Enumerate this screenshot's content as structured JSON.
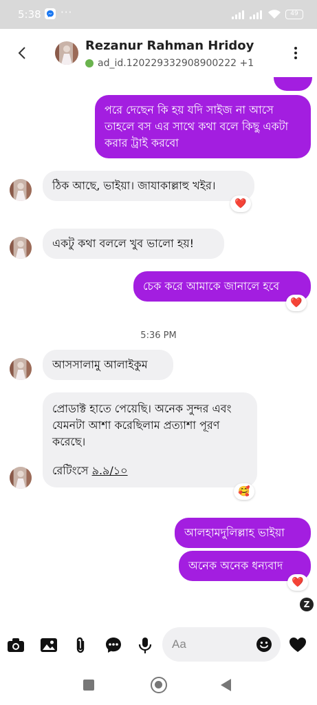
{
  "status": {
    "time": "5:38",
    "dots": "···",
    "battery": "49"
  },
  "header": {
    "contact_name": "Rezanur Rahman Hridoy",
    "sub_id": "ad_id.120229332908900222 +1"
  },
  "messages": {
    "m1_out": "পরে দেছেন কি হয় যদি সাইজ না আসে তাহলে বস এর সাথে কথা বলে কিছু একটা করার ট্রাই করবো",
    "m2_in": "ঠিক আছে, ভাইয়া। জাযাকাল্লাহু খইর।",
    "m2_reaction": "❤️",
    "m3_in": "একটু কথা বললে খুব ভালো হয়!",
    "m4_out": "চেক করে আমাকে জানালে হবে",
    "m4_reaction": "❤️",
    "time_separator": "5:36 PM",
    "m5_in": "আসসালামু আলাইকুম",
    "m6_in_p1": "প্রোডাক্ট হাতে পেয়েছি। অনেক সুন্দর এবং যেমনটা আশা করেছিলাম প্রত্যাশা পূরণ করেছে।",
    "m6_in_p2_label": "রেটিংসে ",
    "m6_in_p2_value": "৯.৯/১০",
    "m6_reaction": "🥰",
    "m7_out": "আলহামদুলিল্লাহ ভাইয়া",
    "m8_out": "অনেক অনেক ধন্যবাদ",
    "m8_reaction": "❤️",
    "seen_badge": "Z"
  },
  "composer": {
    "placeholder": "Aa"
  },
  "icons": {
    "back": "chevron-left-icon",
    "more": "more-vertical-icon",
    "camera": "camera-icon",
    "gallery": "image-icon",
    "attach": "paperclip-icon",
    "chat": "chat-bubble-icon",
    "mic": "microphone-icon",
    "emoji": "emoji-icon",
    "like": "heart-icon"
  },
  "colors": {
    "outgoing": "#a31ee0",
    "incoming": "#f0f0f2",
    "online": "#6ab34e"
  }
}
